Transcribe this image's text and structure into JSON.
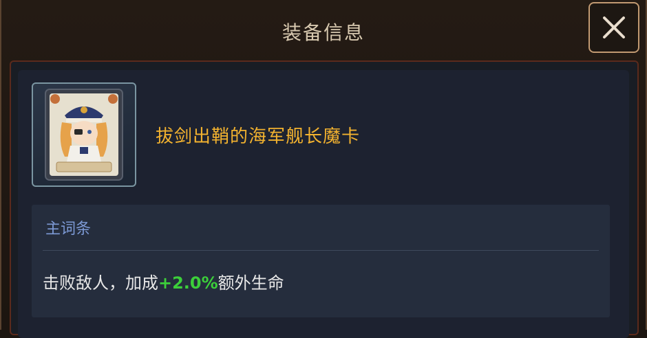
{
  "dialog": {
    "title": "装备信息",
    "close_icon": "close-icon"
  },
  "item": {
    "name": "拔剑出鞘的海军舰长魔卡",
    "icon": "navy-captain-card-icon",
    "name_color": "#f2b22f"
  },
  "main_affix": {
    "header": "主词条",
    "effect_prefix": "击败敌人，加成",
    "effect_value": "+2.0%",
    "effect_suffix": "额外生命",
    "value_color": "#3ccf3a"
  }
}
